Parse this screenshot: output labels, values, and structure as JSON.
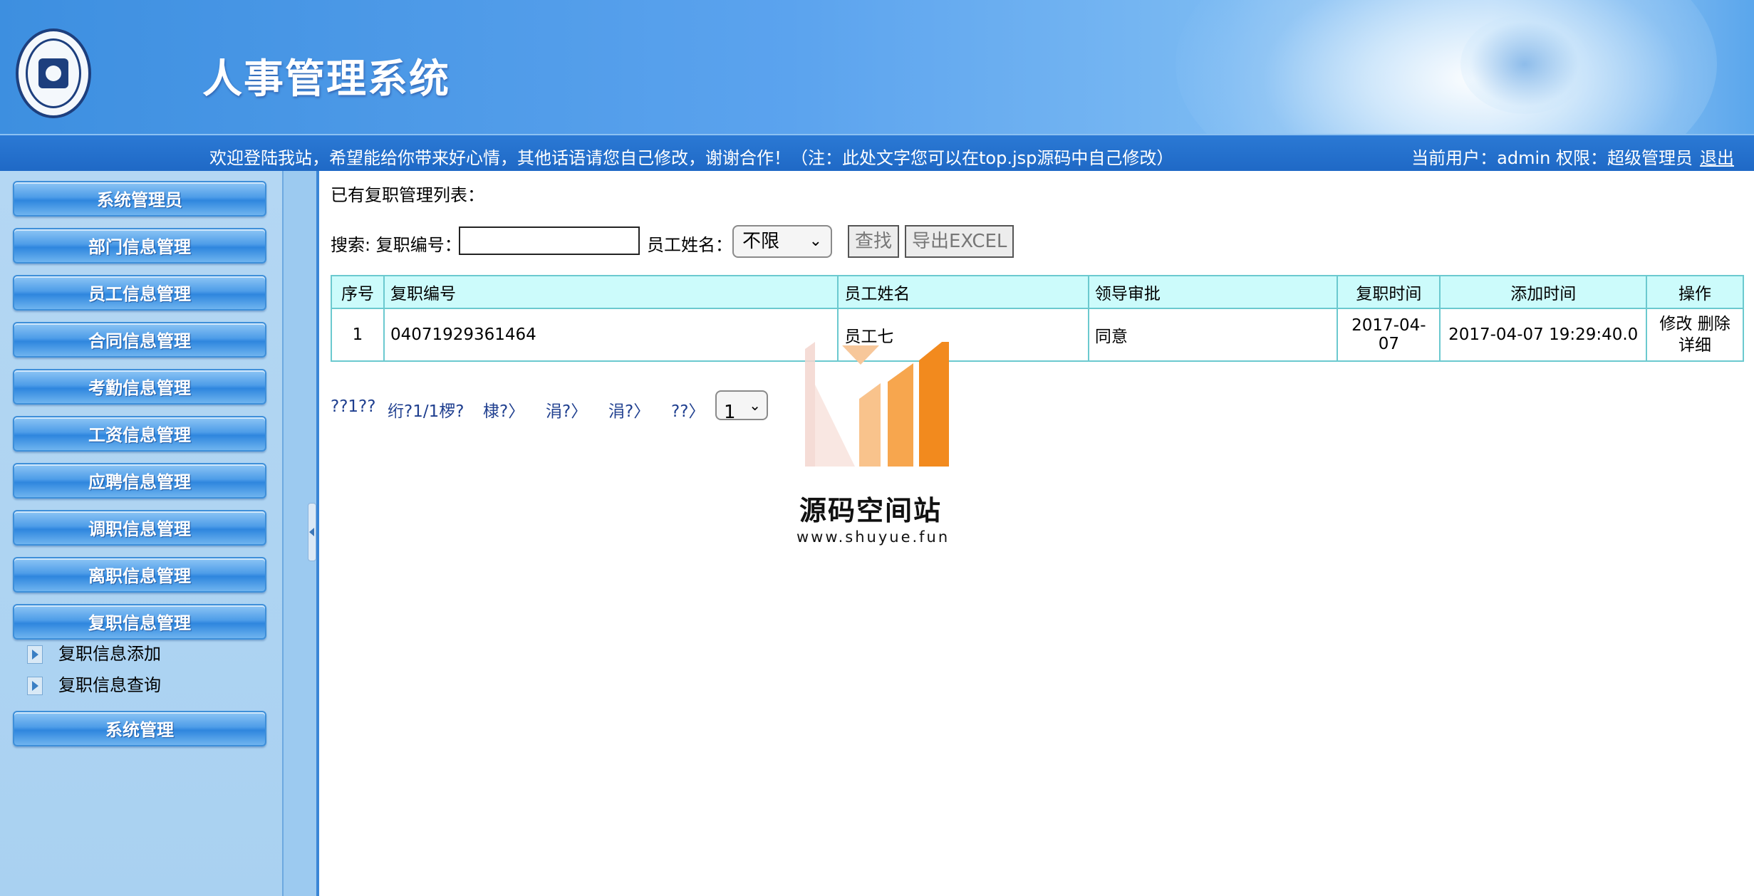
{
  "header": {
    "app_title": "人事管理系统",
    "welcome": "欢迎登陆我站，希望能给你带来好心情，其他话语请您自己修改，谢谢合作！（注：此处文字您可以在top.jsp源码中自己修改）",
    "user_info": "当前用户：admin 权限：超级管理员",
    "logout_label": "退出"
  },
  "sidebar": {
    "items": [
      {
        "label": "系统管理员"
      },
      {
        "label": "部门信息管理"
      },
      {
        "label": "员工信息管理"
      },
      {
        "label": "合同信息管理"
      },
      {
        "label": "考勤信息管理"
      },
      {
        "label": "工资信息管理"
      },
      {
        "label": "应聘信息管理"
      },
      {
        "label": "调职信息管理"
      },
      {
        "label": "离职信息管理"
      },
      {
        "label": "复职信息管理"
      },
      {
        "label": "系统管理"
      }
    ],
    "subitems": [
      {
        "label": "复职信息添加"
      },
      {
        "label": "复职信息查询"
      }
    ]
  },
  "main": {
    "list_title": "已有复职管理列表：",
    "search": {
      "label": "搜索: 复职编号：",
      "name_label": "员工姓名：",
      "input_value": "",
      "select_value": "不限",
      "search_btn": "查找",
      "export_btn": "导出EXCEL"
    },
    "table": {
      "headers": [
        "序号",
        "复职编号",
        "员工姓名",
        "领导审批",
        "复职时间",
        "添加时间",
        "操作"
      ],
      "rows": [
        {
          "index": "1",
          "code": "04071929361464",
          "name": "员工七",
          "approval": "同意",
          "date": "2017-04-07",
          "added": "2017-04-07 19:29:40.0",
          "edit": "修改",
          "delete": "删除",
          "detail": "详细"
        }
      ]
    },
    "pager": {
      "items": [
        "??1??",
        "绗?1/1椤?",
        "棣?〉",
        "涓?〉",
        "涓?〉",
        "??〉"
      ],
      "page_select": "1"
    }
  },
  "watermark": {
    "title": "源码空间站",
    "url": "www.shuyue.fun"
  }
}
